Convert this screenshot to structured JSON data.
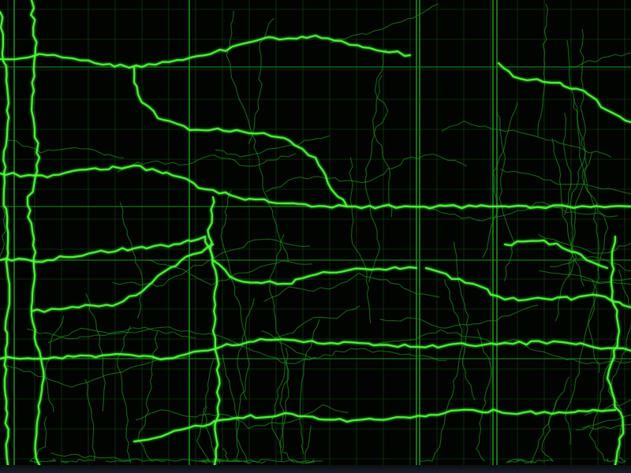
{
  "scene": {
    "kind": "network-texture",
    "colors": {
      "background": "#020402",
      "grid": "#1f7a1f",
      "vein_bright": "#4cff3a",
      "vein_dim": "#1e8c1e",
      "strip": "#1a1f2a"
    }
  }
}
